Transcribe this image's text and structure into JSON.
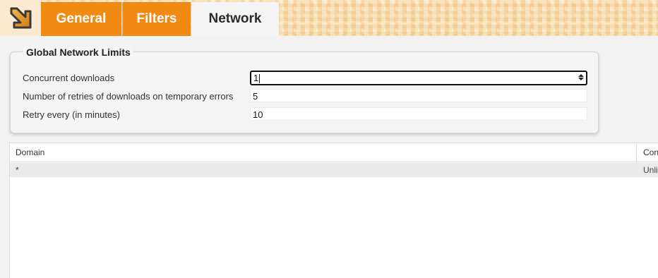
{
  "tabs": [
    {
      "label": "General",
      "active": false
    },
    {
      "label": "Filters",
      "active": false
    },
    {
      "label": "Network",
      "active": true
    }
  ],
  "logo_icon": "download-arrow-icon",
  "group": {
    "title": "Global Network Limits",
    "fields": [
      {
        "label": "Concurrent downloads",
        "value": "1"
      },
      {
        "label": "Number of retries of downloads on temporary errors",
        "value": "5"
      },
      {
        "label": "Retry every (in minutes)",
        "value": "10"
      }
    ]
  },
  "table": {
    "headers": [
      "Domain",
      "Con"
    ],
    "rows": [
      [
        "*",
        "Unli"
      ]
    ]
  },
  "colors": {
    "tab_orange": "#f08a12",
    "active_tab": "#f4f4f4"
  }
}
